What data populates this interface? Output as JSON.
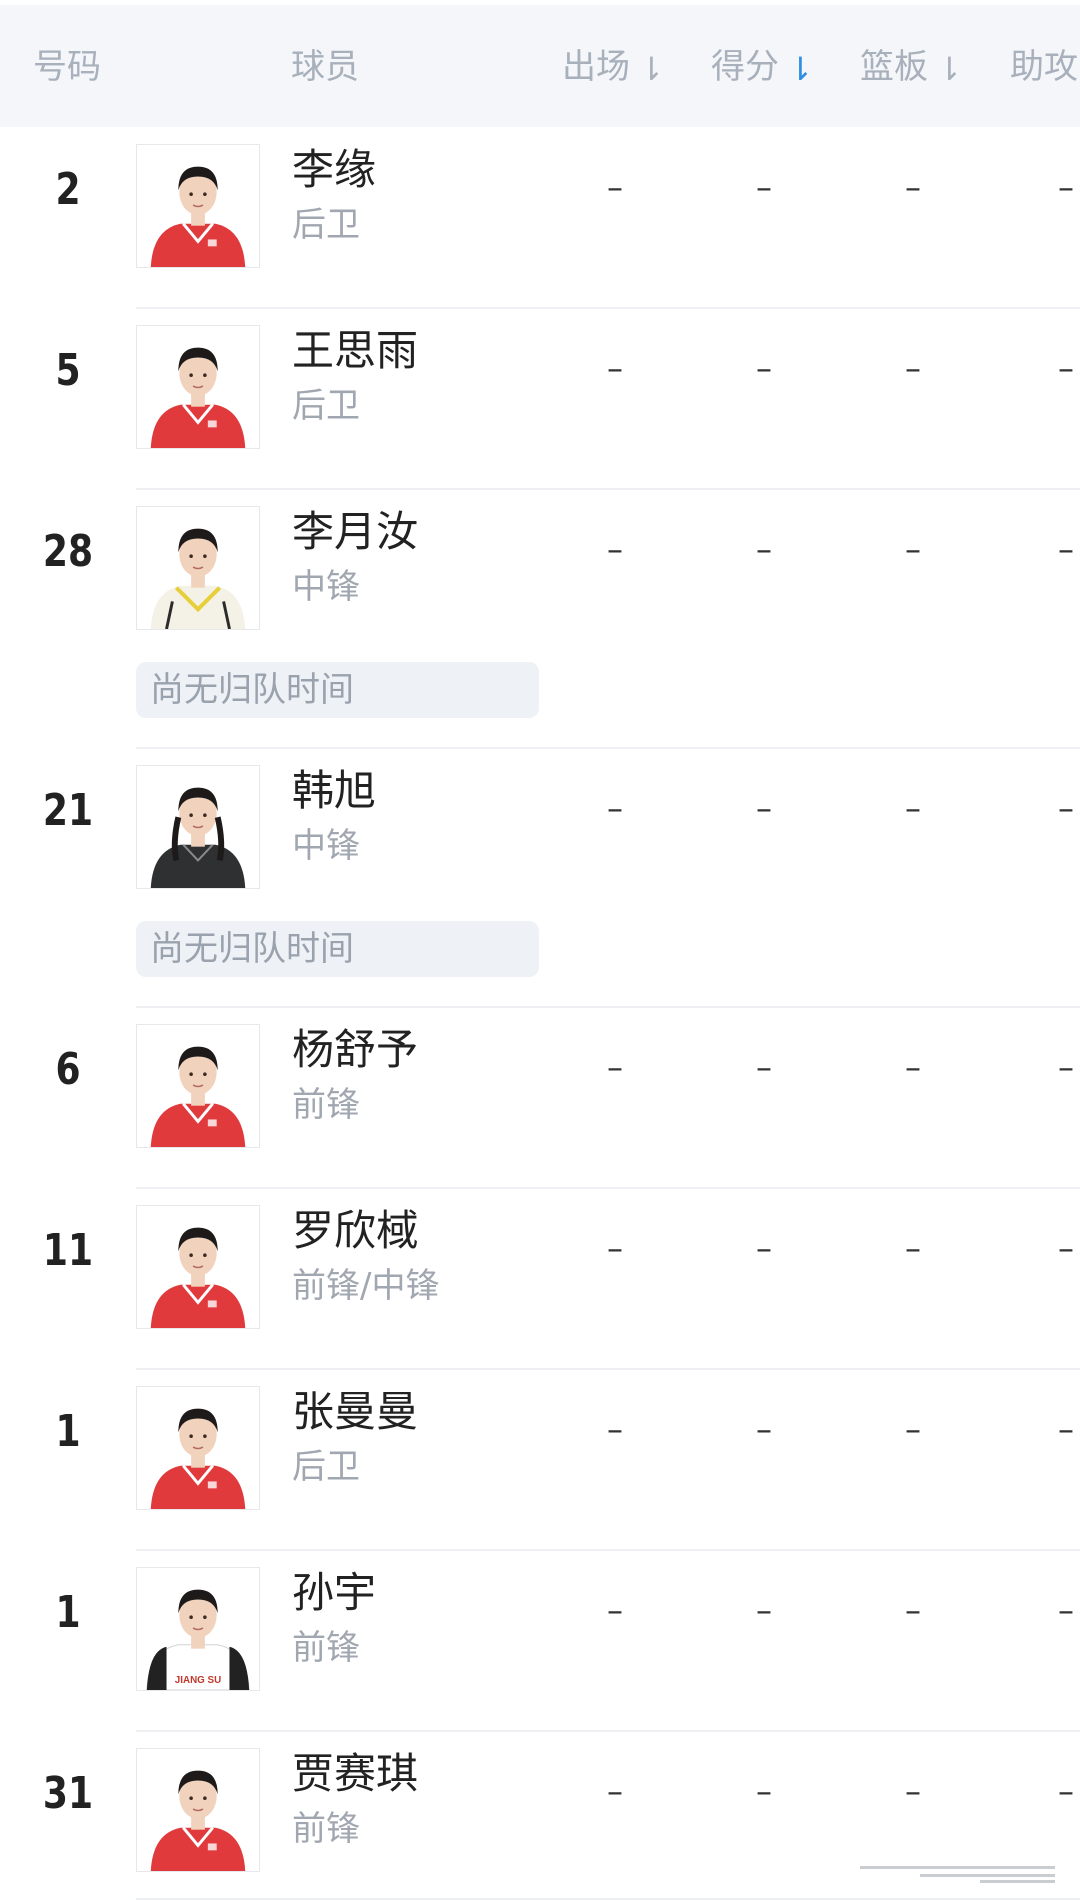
{
  "header": {
    "col_number": "号码",
    "col_player": "球员",
    "col_games": "出场",
    "col_points": "得分",
    "col_rebounds": "篮板",
    "col_assists": "助攻",
    "sort_mark": "⇂",
    "active_sort": "points",
    "accent_color": "#2c8fe2"
  },
  "players": [
    {
      "number": "2",
      "name": "李缘",
      "position": "后卫",
      "games": "–",
      "points": "–",
      "rebounds": "–",
      "assists": "–",
      "jersey": "red"
    },
    {
      "number": "5",
      "name": "王思雨",
      "position": "后卫",
      "games": "–",
      "points": "–",
      "rebounds": "–",
      "assists": "–",
      "jersey": "red"
    },
    {
      "number": "28",
      "name": "李月汝",
      "position": "中锋",
      "games": "–",
      "points": "–",
      "rebounds": "–",
      "assists": "–",
      "jersey": "white-yellow",
      "note": "尚无归队时间"
    },
    {
      "number": "21",
      "name": "韩旭",
      "position": "中锋",
      "games": "–",
      "points": "–",
      "rebounds": "–",
      "assists": "–",
      "jersey": "dark",
      "note": "尚无归队时间"
    },
    {
      "number": "6",
      "name": "杨舒予",
      "position": "前锋",
      "games": "–",
      "points": "–",
      "rebounds": "–",
      "assists": "–",
      "jersey": "red"
    },
    {
      "number": "11",
      "name": "罗欣棫",
      "position": "前锋/中锋",
      "games": "–",
      "points": "–",
      "rebounds": "–",
      "assists": "–",
      "jersey": "red"
    },
    {
      "number": "1",
      "name": "张曼曼",
      "position": "后卫",
      "games": "–",
      "points": "–",
      "rebounds": "–",
      "assists": "–",
      "jersey": "red"
    },
    {
      "number": "1",
      "name": "孙宇",
      "position": "前锋",
      "games": "–",
      "points": "–",
      "rebounds": "–",
      "assists": "–",
      "jersey": "jiangsu",
      "jersey_text": "JIANG SU"
    },
    {
      "number": "31",
      "name": "贾赛琪",
      "position": "前锋",
      "games": "–",
      "points": "–",
      "rebounds": "–",
      "assists": "–",
      "jersey": "red"
    }
  ],
  "colors": {
    "header_bg": "#f4f6f9",
    "header_text": "#a8b0bc",
    "badge_bg": "#eef1f5",
    "jersey_red": "#e03a3c"
  }
}
